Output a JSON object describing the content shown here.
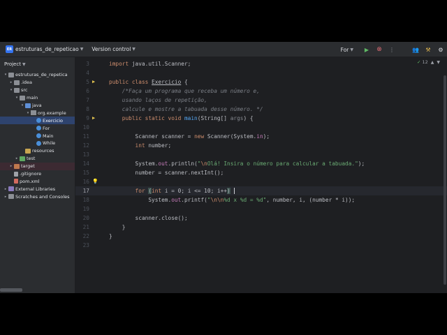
{
  "titlebar": {
    "project_badge": "ER",
    "project_name": "estruturas_de_repeticao",
    "vcs_label": "Version control",
    "run_config": "For",
    "icons": [
      "run-icon",
      "stop-icon",
      "more-icon",
      "people-icon",
      "tools-icon",
      "settings-icon"
    ]
  },
  "project_panel": {
    "title": "Project",
    "tree": [
      {
        "label": "estruturas_de_repetica",
        "indent": 0,
        "arrow": "▾",
        "icon": "folder"
      },
      {
        "label": ".idea",
        "indent": 1,
        "arrow": "▸",
        "icon": "folder"
      },
      {
        "label": "src",
        "indent": 1,
        "arrow": "▾",
        "icon": "folder"
      },
      {
        "label": "main",
        "indent": 2,
        "arrow": "▾",
        "icon": "folder"
      },
      {
        "label": "java",
        "indent": 3,
        "arrow": "▾",
        "icon": "folder-src"
      },
      {
        "label": "org.example",
        "indent": 4,
        "arrow": "▾",
        "icon": "pkg"
      },
      {
        "label": "Exercicio",
        "indent": 5,
        "arrow": "",
        "icon": "cls",
        "selected": true
      },
      {
        "label": "For",
        "indent": 5,
        "arrow": "",
        "icon": "cls"
      },
      {
        "label": "Main",
        "indent": 5,
        "arrow": "",
        "icon": "cls"
      },
      {
        "label": "While",
        "indent": 5,
        "arrow": "",
        "icon": "cls"
      },
      {
        "label": "resources",
        "indent": 3,
        "arrow": "",
        "icon": "folder-res"
      },
      {
        "label": "test",
        "indent": 2,
        "arrow": "▸",
        "icon": "folder-test"
      },
      {
        "label": "target",
        "indent": 1,
        "arrow": "▸",
        "icon": "folder-excl",
        "excluded": true
      },
      {
        "label": ".gitignore",
        "indent": 1,
        "arrow": "",
        "icon": "file"
      },
      {
        "label": "pom.xml",
        "indent": 1,
        "arrow": "",
        "icon": "xml"
      },
      {
        "label": "External Libraries",
        "indent": 0,
        "arrow": "▸",
        "icon": "lib"
      },
      {
        "label": "Scratches and Consoles",
        "indent": 0,
        "arrow": "▸",
        "icon": "folder"
      }
    ]
  },
  "editor": {
    "inspection_count": "12",
    "current_line": "17",
    "lines": [
      {
        "n": "3",
        "tokens": [
          [
            "kw",
            "import "
          ],
          [
            "",
            "java.util.Scanner;"
          ]
        ]
      },
      {
        "n": "4",
        "tokens": []
      },
      {
        "n": "5",
        "gutter": "run",
        "tokens": [
          [
            "kw",
            "public class "
          ],
          [
            "cls-decl",
            "Exercicio"
          ],
          [
            "",
            " {"
          ]
        ]
      },
      {
        "n": "6",
        "tokens": [
          [
            "cmt",
            "    /*Faça um programa que receba um número e,"
          ]
        ]
      },
      {
        "n": "7",
        "tokens": [
          [
            "cmt",
            "    usando laços de repetição,"
          ]
        ]
      },
      {
        "n": "8",
        "tokens": [
          [
            "cmt",
            "    calcule e mostre a tabuada desse número. */"
          ]
        ]
      },
      {
        "n": "9",
        "gutter": "run",
        "tokens": [
          [
            "kw",
            "    public static void "
          ],
          [
            "fn",
            "main"
          ],
          [
            "",
            "(String[] "
          ],
          [
            "unused",
            "args"
          ],
          [
            "",
            ") {"
          ]
        ]
      },
      {
        "n": "10",
        "tokens": []
      },
      {
        "n": "11",
        "tokens": [
          [
            "",
            "        Scanner scanner = "
          ],
          [
            "kw",
            "new "
          ],
          [
            "",
            "Scanner(System."
          ],
          [
            "fld",
            "in"
          ],
          [
            "",
            ");"
          ]
        ]
      },
      {
        "n": "12",
        "tokens": [
          [
            "kw",
            "        int "
          ],
          [
            "",
            "number;"
          ]
        ]
      },
      {
        "n": "13",
        "tokens": []
      },
      {
        "n": "14",
        "tokens": [
          [
            "",
            "        System."
          ],
          [
            "fld",
            "out"
          ],
          [
            "",
            ".println("
          ],
          [
            "str",
            "\""
          ],
          [
            "esc",
            "\\n"
          ],
          [
            "str",
            "Olá! Insira o número para calcular a tabuada.\""
          ],
          [
            "",
            ");"
          ]
        ]
      },
      {
        "n": "15",
        "tokens": [
          [
            "",
            "        number = scanner.nextInt();"
          ]
        ]
      },
      {
        "n": "16",
        "gutter": "bulb",
        "tokens": []
      },
      {
        "n": "17",
        "tokens": [
          [
            "kw",
            "        for "
          ],
          [
            "brace-hl",
            "("
          ],
          [
            "kw",
            "int "
          ],
          [
            "",
            "i = "
          ],
          [
            "",
            "0"
          ],
          [
            "",
            "; i <= "
          ],
          [
            "",
            "10"
          ],
          [
            "",
            "; i++"
          ],
          [
            "brace-hl",
            ")"
          ],
          [
            "",
            " "
          ],
          [
            "cursor",
            ""
          ]
        ]
      },
      {
        "n": "18",
        "tokens": [
          [
            "",
            "            System."
          ],
          [
            "fld",
            "out"
          ],
          [
            "",
            ".printf("
          ],
          [
            "str",
            "\""
          ],
          [
            "esc",
            "\\n\\n"
          ],
          [
            "str",
            "%d x %d = %d\""
          ],
          [
            "",
            ", number, i, (number * i));"
          ]
        ]
      },
      {
        "n": "19",
        "tokens": []
      },
      {
        "n": "20",
        "tokens": [
          [
            "",
            "        scanner.close();"
          ]
        ]
      },
      {
        "n": "21",
        "tokens": [
          [
            "",
            "    }"
          ]
        ]
      },
      {
        "n": "22",
        "tokens": [
          [
            "",
            "}"
          ]
        ]
      },
      {
        "n": "23",
        "tokens": []
      }
    ]
  }
}
